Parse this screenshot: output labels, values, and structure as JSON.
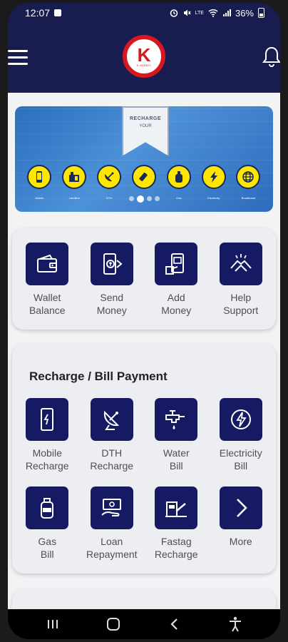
{
  "status_bar": {
    "time": "12:07",
    "battery": "36%",
    "icons": [
      "image-icon",
      "alarm-icon",
      "mute-icon",
      "lte-icon",
      "wifi-icon",
      "signal-icon",
      "battery-icon"
    ]
  },
  "app_bar": {
    "menu_icon": "hamburger-icon",
    "logo_letter": "K",
    "logo_text": "K-MONEY",
    "bell_icon": "bell-icon"
  },
  "banner": {
    "ribbon_line1": "RECHARGE",
    "ribbon_line2": "YOUR",
    "items": [
      {
        "label": "Mobile",
        "icon": "mobile-icon"
      },
      {
        "label": "Landline",
        "icon": "landline-icon"
      },
      {
        "label": "DTH",
        "icon": "dish-icon"
      },
      {
        "label": "Datacard",
        "icon": "usb-icon"
      },
      {
        "label": "Gas",
        "icon": "gas-cylinder-icon"
      },
      {
        "label": "Electricity",
        "icon": "lightning-icon"
      },
      {
        "label": "Broadband",
        "icon": "globe-icon"
      }
    ],
    "dots_count": 4,
    "active_dot": 2
  },
  "quick_actions": [
    {
      "label": "Wallet\nBalance",
      "icon": "wallet-icon"
    },
    {
      "label": "Send\nMoney",
      "icon": "send-money-icon"
    },
    {
      "label": "Add\nMoney",
      "icon": "add-money-icon"
    },
    {
      "label": "Help\nSupport",
      "icon": "handshake-icon"
    }
  ],
  "recharge": {
    "title": "Recharge / Bill Payment",
    "items": [
      {
        "label": "Mobile\nRecharge",
        "icon": "mobile-recharge-icon"
      },
      {
        "label": "DTH\nRecharge",
        "icon": "dth-icon"
      },
      {
        "label": "Water\nBill",
        "icon": "water-tap-icon"
      },
      {
        "label": "Electricity\nBill",
        "icon": "electricity-icon"
      },
      {
        "label": "Gas\nBill",
        "icon": "gas-bill-icon"
      },
      {
        "label": "Loan\nRepayment",
        "icon": "loan-icon"
      },
      {
        "label": "Fastag\nRecharge",
        "icon": "toll-icon"
      },
      {
        "label": "More",
        "icon": "chevron-right-icon"
      }
    ]
  },
  "colors": {
    "header": "#181c4f",
    "tile": "#151a63",
    "brand_red": "#d7191f",
    "banner_yellow": "#ffe600"
  }
}
